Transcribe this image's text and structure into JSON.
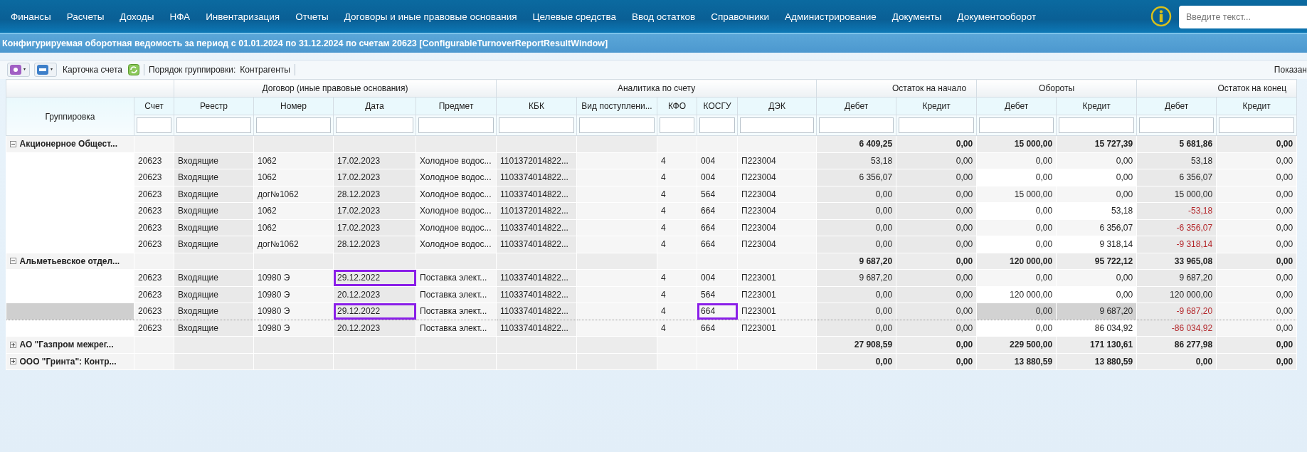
{
  "nav": {
    "items": [
      "Финансы",
      "Расчеты",
      "Доходы",
      "НФА",
      "Инвентаризация",
      "Отчеты",
      "Договоры и иные правовые основания",
      "Целевые средства",
      "Ввод остатков",
      "Справочники",
      "Администрирование",
      "Документы",
      "Документооборот"
    ],
    "search": {
      "placeholder": "Введите текст..."
    }
  },
  "window": {
    "title": "Конфигурируемая оборотная ведомость за период с 01.01.2024 по 31.12.2024 по счетам 20623 [ConfigurableTurnoverReportResultWindow]"
  },
  "toolbar": {
    "account_card": "Карточка счета",
    "grouping_label": "Порядок группировки:",
    "grouping_value": "Контрагенты",
    "shown": "Показан"
  },
  "table": {
    "group_headers": [
      "Договор (иные правовые основания)",
      "Аналитика по счету",
      "Остаток на начало",
      "Обороты",
      "Остаток на конец"
    ],
    "columns": [
      "Группировка",
      "Счет",
      "Реестр",
      "Номер",
      "Дата",
      "Предмет",
      "КБК",
      "Вид поступлени...",
      "КФО",
      "КОСГУ",
      "ДЭК",
      "Дебет",
      "Кредит",
      "Дебет",
      "Кредит",
      "Дебет",
      "Кредит"
    ],
    "groups": [
      {
        "name": "Акционерное Общест...",
        "expanded": true,
        "totals": [
          "6 409,25",
          "0,00",
          "15 000,00",
          "15 727,39",
          "5 681,86",
          "0,00"
        ],
        "rows": [
          {
            "selected": false,
            "marked_date": false,
            "marked_kosgu": false,
            "negative_end": false,
            "cells": [
              "20623",
              "Входящие",
              "1062",
              "17.02.2023",
              "Холодное водос...",
              "1101372014822...",
              "",
              "4",
              "004",
              "П223004",
              "53,18",
              "0,00",
              "0,00",
              "0,00",
              "53,18",
              "0,00"
            ]
          },
          {
            "selected": false,
            "marked_date": false,
            "marked_kosgu": false,
            "negative_end": false,
            "cells": [
              "20623",
              "Входящие",
              "1062",
              "17.02.2023",
              "Холодное водос...",
              "1103374014822...",
              "",
              "4",
              "004",
              "П223004",
              "6 356,07",
              "0,00",
              "0,00",
              "0,00",
              "6 356,07",
              "0,00"
            ]
          },
          {
            "selected": false,
            "marked_date": false,
            "marked_kosgu": false,
            "negative_end": false,
            "cells": [
              "20623",
              "Входящие",
              "дог№1062",
              "28.12.2023",
              "Холодное водос...",
              "1103374014822...",
              "",
              "4",
              "564",
              "П223004",
              "0,00",
              "0,00",
              "15 000,00",
              "0,00",
              "15 000,00",
              "0,00"
            ]
          },
          {
            "selected": false,
            "marked_date": false,
            "marked_kosgu": false,
            "negative_end": true,
            "cells": [
              "20623",
              "Входящие",
              "1062",
              "17.02.2023",
              "Холодное водос...",
              "1101372014822...",
              "",
              "4",
              "664",
              "П223004",
              "0,00",
              "0,00",
              "0,00",
              "53,18",
              "-53,18",
              "0,00"
            ]
          },
          {
            "selected": false,
            "marked_date": false,
            "marked_kosgu": false,
            "negative_end": true,
            "cells": [
              "20623",
              "Входящие",
              "1062",
              "17.02.2023",
              "Холодное водос...",
              "1103374014822...",
              "",
              "4",
              "664",
              "П223004",
              "0,00",
              "0,00",
              "0,00",
              "6 356,07",
              "-6 356,07",
              "0,00"
            ]
          },
          {
            "selected": false,
            "marked_date": false,
            "marked_kosgu": false,
            "negative_end": true,
            "cells": [
              "20623",
              "Входящие",
              "дог№1062",
              "28.12.2023",
              "Холодное водос...",
              "1103374014822...",
              "",
              "4",
              "664",
              "П223004",
              "0,00",
              "0,00",
              "0,00",
              "9 318,14",
              "-9 318,14",
              "0,00"
            ]
          }
        ]
      },
      {
        "name": "Альметьевское отдел...",
        "expanded": true,
        "totals": [
          "9 687,20",
          "0,00",
          "120 000,00",
          "95 722,12",
          "33 965,08",
          "0,00"
        ],
        "rows": [
          {
            "selected": false,
            "marked_date": true,
            "marked_kosgu": false,
            "negative_end": false,
            "cells": [
              "20623",
              "Входящие",
              "10980 Э",
              "29.12.2022",
              "Поставка элект...",
              "1103374014822...",
              "",
              "4",
              "004",
              "П223001",
              "9 687,20",
              "0,00",
              "0,00",
              "0,00",
              "9 687,20",
              "0,00"
            ]
          },
          {
            "selected": false,
            "marked_date": false,
            "marked_kosgu": false,
            "negative_end": false,
            "cells": [
              "20623",
              "Входящие",
              "10980 Э",
              "20.12.2023",
              "Поставка элект...",
              "1103374014822...",
              "",
              "4",
              "564",
              "П223001",
              "0,00",
              "0,00",
              "120 000,00",
              "0,00",
              "120 000,00",
              "0,00"
            ]
          },
          {
            "selected": true,
            "marked_date": true,
            "marked_kosgu": true,
            "negative_end": true,
            "cells": [
              "20623",
              "Входящие",
              "10980 Э",
              "29.12.2022",
              "Поставка элект...",
              "1103374014822...",
              "",
              "4",
              "664",
              "П223001",
              "0,00",
              "0,00",
              "0,00",
              "9 687,20",
              "-9 687,20",
              "0,00"
            ]
          },
          {
            "selected": false,
            "marked_date": false,
            "marked_kosgu": false,
            "negative_end": true,
            "cells": [
              "20623",
              "Входящие",
              "10980 Э",
              "20.12.2023",
              "Поставка элект...",
              "1103374014822...",
              "",
              "4",
              "664",
              "П223001",
              "0,00",
              "0,00",
              "0,00",
              "86 034,92",
              "-86 034,92",
              "0,00"
            ]
          }
        ]
      },
      {
        "name": "АО \"Газпром межрег...",
        "expanded": false,
        "totals": [
          "27 908,59",
          "0,00",
          "229 500,00",
          "171 130,61",
          "86 277,98",
          "0,00"
        ]
      },
      {
        "name": "ООО \"Гринта\": Контр...",
        "expanded": false,
        "totals": [
          "0,00",
          "0,00",
          "13 880,59",
          "13 880,59",
          "0,00",
          "0,00"
        ]
      }
    ]
  }
}
